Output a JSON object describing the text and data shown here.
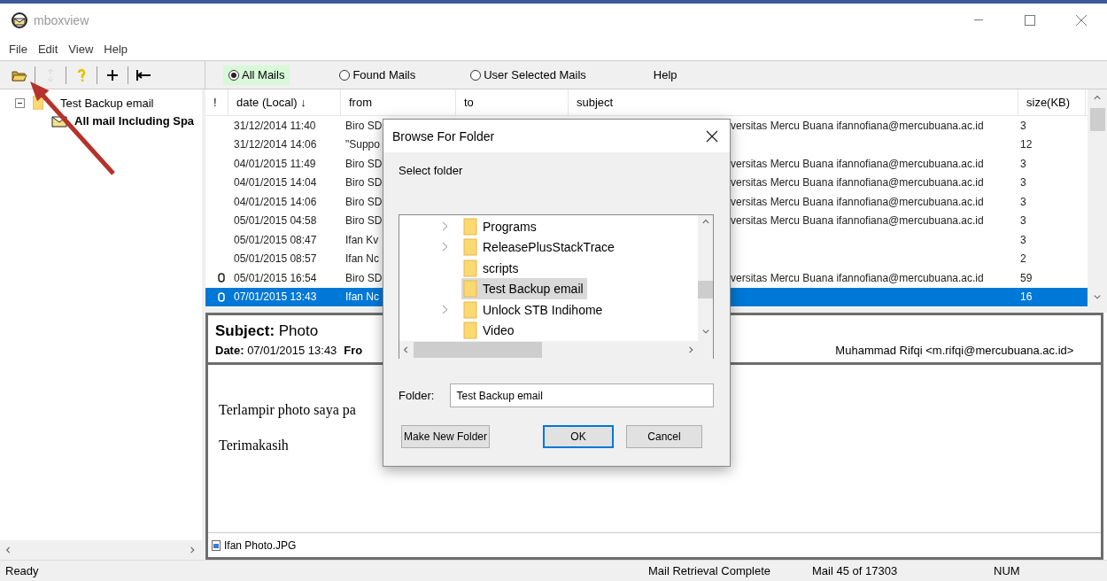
{
  "window": {
    "title": "mboxview"
  },
  "menu": [
    "File",
    "Edit",
    "View",
    "Help"
  ],
  "toolbar": [
    {
      "kind": "open",
      "disabled": false
    },
    {
      "kind": "refresh",
      "disabled": true
    },
    {
      "kind": "help",
      "disabled": false
    },
    {
      "kind": "add",
      "disabled": false
    },
    {
      "kind": "collapse",
      "disabled": false
    }
  ],
  "view_options": [
    {
      "label": "All Mails",
      "selected": true
    },
    {
      "label": "Found Mails",
      "selected": false
    },
    {
      "label": "User Selected Mails",
      "selected": false
    }
  ],
  "help_label": "Help",
  "folder_tree": [
    {
      "label": "Test Backup email",
      "expanded": true,
      "children": [
        {
          "label": "All mail Including Spa"
        }
      ]
    }
  ],
  "mail_table": {
    "columns": [
      "!",
      "date (Local) ↓",
      "from",
      "to",
      "subject",
      "size(KB)"
    ],
    "rows": [
      {
        "attachment": false,
        "date": "31/12/2014 11:40",
        "from": "Biro SD",
        "subject": "versitas Mercu Buana ifannofiana@mercubuana.ac.id",
        "size": "3",
        "selected": false
      },
      {
        "attachment": false,
        "date": "31/12/2014 14:06",
        "from": "\"Suppo",
        "subject": "",
        "size": "12",
        "selected": false
      },
      {
        "attachment": false,
        "date": "04/01/2015 11:49",
        "from": "Biro SD",
        "subject": "versitas Mercu Buana ifannofiana@mercubuana.ac.id",
        "size": "3",
        "selected": false
      },
      {
        "attachment": false,
        "date": "04/01/2015 14:04",
        "from": "Biro SD",
        "subject": "versitas Mercu Buana ifannofiana@mercubuana.ac.id",
        "size": "3",
        "selected": false
      },
      {
        "attachment": false,
        "date": "04/01/2015 14:06",
        "from": "Biro SD",
        "subject": "versitas Mercu Buana ifannofiana@mercubuana.ac.id",
        "size": "3",
        "selected": false
      },
      {
        "attachment": false,
        "date": "05/01/2015 04:58",
        "from": "Biro SD",
        "subject": "versitas Mercu Buana ifannofiana@mercubuana.ac.id",
        "size": "3",
        "selected": false
      },
      {
        "attachment": false,
        "date": "05/01/2015 08:47",
        "from": "Ifan Kv",
        "subject": "",
        "size": "3",
        "selected": false
      },
      {
        "attachment": false,
        "date": "05/01/2015 08:57",
        "from": "Ifan Nc",
        "subject": "",
        "size": "2",
        "selected": false
      },
      {
        "attachment": true,
        "date": "05/01/2015 16:54",
        "from": "Biro SD",
        "subject": "versitas Mercu Buana ifannofiana@mercubuana.ac.id",
        "size": "59",
        "selected": false
      },
      {
        "attachment": true,
        "date": "07/01/2015 13:43",
        "from": "Ifan Nc",
        "subject": "",
        "size": "16",
        "selected": true
      }
    ]
  },
  "preview": {
    "subject_label": "Subject:",
    "subject": "Photo",
    "date_label": "Date:",
    "date": "07/01/2015 13:43",
    "from_label": "Fro",
    "recipient": "Muhammad Rifqi <m.rifqi@mercubuana.ac.id>",
    "body": [
      "Terlampir photo saya pa",
      "Terimakasih"
    ],
    "attachment": "Ifan Photo.JPG"
  },
  "dialog": {
    "title": "Browse For Folder",
    "prompt": "Select folder",
    "folders": [
      {
        "label": "Programs",
        "expandable": true,
        "selected": false
      },
      {
        "label": "ReleasePlusStackTrace",
        "expandable": true,
        "selected": false
      },
      {
        "label": "scripts",
        "expandable": false,
        "selected": false
      },
      {
        "label": "Test Backup email",
        "expandable": false,
        "selected": true
      },
      {
        "label": "Unlock STB Indihome",
        "expandable": true,
        "selected": false
      },
      {
        "label": "Video",
        "expandable": false,
        "selected": false
      }
    ],
    "folder_label": "Folder:",
    "folder_value": "Test Backup email",
    "buttons": [
      {
        "label": "Make New Folder",
        "default": false
      },
      {
        "label": "OK",
        "default": true
      },
      {
        "label": "Cancel",
        "default": false
      }
    ]
  },
  "status_bar": [
    "Ready",
    "Mail Retrieval Complete",
    "Mail 45 of 17303",
    "NUM"
  ]
}
